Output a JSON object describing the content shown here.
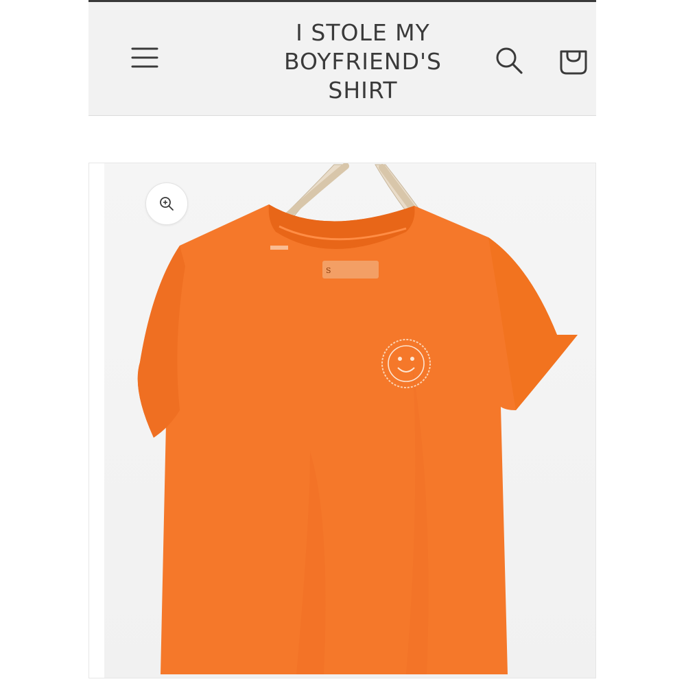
{
  "header": {
    "brand_title": "I STOLE MY\nBOYFRIEND'S\nSHIRT",
    "menu_icon": "hamburger-menu-icon",
    "search_icon": "search-icon",
    "cart_icon": "cart-bag-icon"
  },
  "product": {
    "zoom_icon": "zoom-in-icon",
    "image_subject": "orange-tshirt-on-hanger",
    "shirt_color": "#f5782a",
    "shirt_shadow_color": "#e0621a"
  },
  "colors": {
    "header_bg": "#f2f2f2",
    "text": "#3a3a3a"
  }
}
